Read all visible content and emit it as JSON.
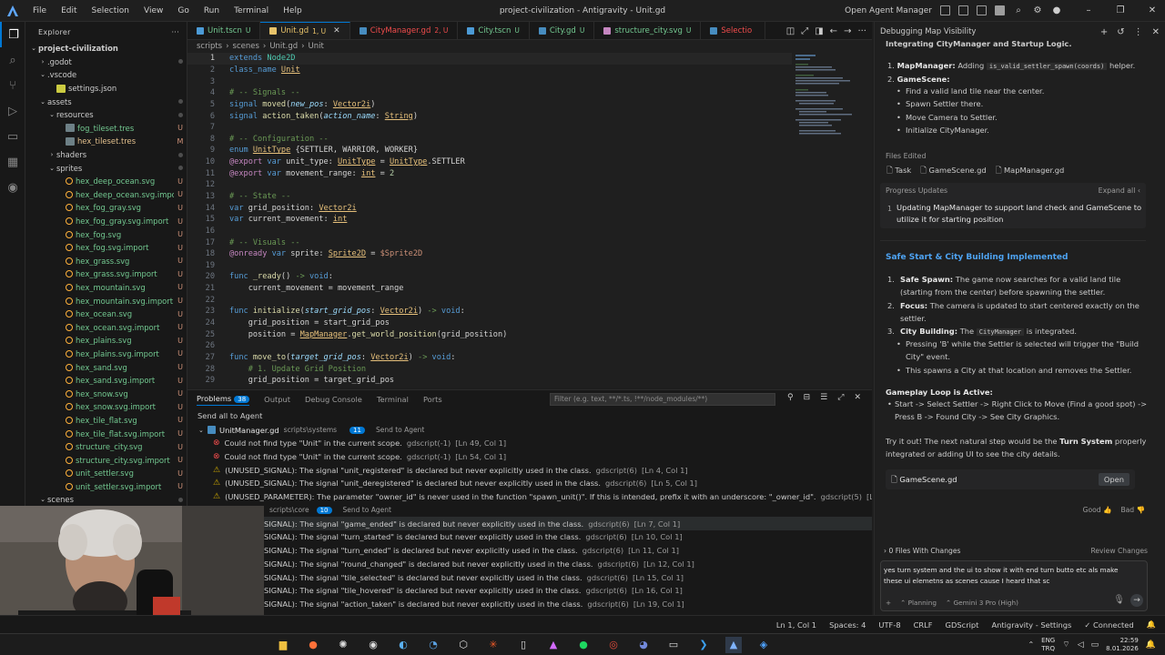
{
  "titlebar": {
    "menu": [
      "File",
      "Edit",
      "Selection",
      "View",
      "Go",
      "Run",
      "Terminal",
      "Help"
    ],
    "title": "project-civilization - Antigravity - Unit.gd",
    "open_agent_manager": "Open Agent Manager"
  },
  "explorer": {
    "header": "Explorer",
    "root": "project-civilization",
    "items": [
      {
        "name": ".godot",
        "depth": 1,
        "chev": "›",
        "type": "folder",
        "status": "",
        "dot": true
      },
      {
        "name": ".vscode",
        "depth": 1,
        "chev": "⌄",
        "type": "folder",
        "status": "",
        "dot": false
      },
      {
        "name": "settings.json",
        "depth": 2,
        "chev": "",
        "type": "json",
        "status": "",
        "dot": false
      },
      {
        "name": "assets",
        "depth": 1,
        "chev": "⌄",
        "type": "folder",
        "status": "",
        "dot": true
      },
      {
        "name": "resources",
        "depth": 2,
        "chev": "⌄",
        "type": "folder",
        "status": "",
        "dot": true
      },
      {
        "name": "fog_tileset.tres",
        "depth": 3,
        "chev": "",
        "type": "tres",
        "status": "U",
        "dot": false
      },
      {
        "name": "hex_tileset.tres",
        "depth": 3,
        "chev": "",
        "type": "tres",
        "status": "M",
        "dot": false
      },
      {
        "name": "shaders",
        "depth": 2,
        "chev": "›",
        "type": "folder",
        "status": "",
        "dot": true
      },
      {
        "name": "sprites",
        "depth": 2,
        "chev": "⌄",
        "type": "folder",
        "status": "",
        "dot": true
      },
      {
        "name": "hex_deep_ocean.svg",
        "depth": 3,
        "chev": "",
        "type": "svg",
        "status": "U",
        "dot": false
      },
      {
        "name": "hex_deep_ocean.svg.import",
        "depth": 3,
        "chev": "",
        "type": "svg",
        "status": "U",
        "dot": false
      },
      {
        "name": "hex_fog_gray.svg",
        "depth": 3,
        "chev": "",
        "type": "svg",
        "status": "U",
        "dot": false
      },
      {
        "name": "hex_fog_gray.svg.import",
        "depth": 3,
        "chev": "",
        "type": "svg",
        "status": "U",
        "dot": false
      },
      {
        "name": "hex_fog.svg",
        "depth": 3,
        "chev": "",
        "type": "svg",
        "status": "U",
        "dot": false
      },
      {
        "name": "hex_fog.svg.import",
        "depth": 3,
        "chev": "",
        "type": "svg",
        "status": "U",
        "dot": false
      },
      {
        "name": "hex_grass.svg",
        "depth": 3,
        "chev": "",
        "type": "svg",
        "status": "U",
        "dot": false
      },
      {
        "name": "hex_grass.svg.import",
        "depth": 3,
        "chev": "",
        "type": "svg",
        "status": "U",
        "dot": false
      },
      {
        "name": "hex_mountain.svg",
        "depth": 3,
        "chev": "",
        "type": "svg",
        "status": "U",
        "dot": false
      },
      {
        "name": "hex_mountain.svg.import",
        "depth": 3,
        "chev": "",
        "type": "svg",
        "status": "U",
        "dot": false
      },
      {
        "name": "hex_ocean.svg",
        "depth": 3,
        "chev": "",
        "type": "svg",
        "status": "U",
        "dot": false
      },
      {
        "name": "hex_ocean.svg.import",
        "depth": 3,
        "chev": "",
        "type": "svg",
        "status": "U",
        "dot": false
      },
      {
        "name": "hex_plains.svg",
        "depth": 3,
        "chev": "",
        "type": "svg",
        "status": "U",
        "dot": false
      },
      {
        "name": "hex_plains.svg.import",
        "depth": 3,
        "chev": "",
        "type": "svg",
        "status": "U",
        "dot": false
      },
      {
        "name": "hex_sand.svg",
        "depth": 3,
        "chev": "",
        "type": "svg",
        "status": "U",
        "dot": false
      },
      {
        "name": "hex_sand.svg.import",
        "depth": 3,
        "chev": "",
        "type": "svg",
        "status": "U",
        "dot": false
      },
      {
        "name": "hex_snow.svg",
        "depth": 3,
        "chev": "",
        "type": "svg",
        "status": "U",
        "dot": false
      },
      {
        "name": "hex_snow.svg.import",
        "depth": 3,
        "chev": "",
        "type": "svg",
        "status": "U",
        "dot": false
      },
      {
        "name": "hex_tile_flat.svg",
        "depth": 3,
        "chev": "",
        "type": "svg",
        "status": "U",
        "dot": false
      },
      {
        "name": "hex_tile_flat.svg.import",
        "depth": 3,
        "chev": "",
        "type": "svg",
        "status": "U",
        "dot": false
      },
      {
        "name": "structure_city.svg",
        "depth": 3,
        "chev": "",
        "type": "svg",
        "status": "U",
        "dot": false
      },
      {
        "name": "structure_city.svg.import",
        "depth": 3,
        "chev": "",
        "type": "svg",
        "status": "U",
        "dot": false
      },
      {
        "name": "unit_settler.svg",
        "depth": 3,
        "chev": "",
        "type": "svg",
        "status": "U",
        "dot": false
      },
      {
        "name": "unit_settler.svg.import",
        "depth": 3,
        "chev": "",
        "type": "svg",
        "status": "U",
        "dot": false
      },
      {
        "name": "scenes",
        "depth": 1,
        "chev": "⌄",
        "type": "folder",
        "status": "",
        "dot": true
      }
    ]
  },
  "tabs": [
    {
      "label": "Unit.tscn",
      "status": "U",
      "color": "#73c991",
      "active": false,
      "icon": "#4c9bd6"
    },
    {
      "label": "Unit.gd",
      "status": "1, U",
      "color": "#e8c36a",
      "active": true,
      "icon": "#e8c36a"
    },
    {
      "label": "CityManager.gd",
      "status": "2, U",
      "color": "#f14c4c",
      "active": false,
      "icon": "#478cbf"
    },
    {
      "label": "City.tscn",
      "status": "U",
      "color": "#73c991",
      "active": false,
      "icon": "#4c9bd6"
    },
    {
      "label": "City.gd",
      "status": "U",
      "color": "#73c991",
      "active": false,
      "icon": "#478cbf"
    },
    {
      "label": "structure_city.svg",
      "status": "U",
      "color": "#73c991",
      "active": false,
      "icon": "#c586c0"
    },
    {
      "label": "Selectio",
      "status": "",
      "color": "#f14c4c",
      "active": false,
      "icon": "#478cbf"
    }
  ],
  "breadcrumb": [
    "scripts",
    "scenes",
    "Unit.gd",
    "Unit"
  ],
  "code": [
    [
      [
        "kw",
        "extends "
      ],
      [
        "ty",
        "Node2D"
      ]
    ],
    [
      [
        "kw",
        "class_name "
      ],
      [
        "cls",
        "Unit"
      ]
    ],
    [],
    [
      [
        "cm",
        "# -- Signals --"
      ]
    ],
    [
      [
        "kw",
        "signal "
      ],
      [
        "fn",
        "moved"
      ],
      [
        "wh",
        "("
      ],
      [
        "pa",
        "new_pos"
      ],
      [
        "wh",
        ": "
      ],
      [
        "cls",
        "Vector2i"
      ],
      [
        "wh",
        ")"
      ]
    ],
    [
      [
        "kw",
        "signal "
      ],
      [
        "fn",
        "action_taken"
      ],
      [
        "wh",
        "("
      ],
      [
        "pa",
        "action_name"
      ],
      [
        "wh",
        ": "
      ],
      [
        "cls",
        "String"
      ],
      [
        "wh",
        ")"
      ]
    ],
    [],
    [
      [
        "cm",
        "# -- Configuration --"
      ]
    ],
    [
      [
        "kw",
        "enum "
      ],
      [
        "cls",
        "UnitType"
      ],
      [
        "wh",
        " {"
      ],
      [
        "wh",
        "SETTLER, WARRIOR, WORKER"
      ],
      [
        "wh",
        "}"
      ]
    ],
    [
      [
        "pl",
        "@export "
      ],
      [
        "kw",
        "var "
      ],
      [
        "wh",
        "unit_type: "
      ],
      [
        "cls",
        "UnitType"
      ],
      [
        "wh",
        " = "
      ],
      [
        "cls",
        "UnitType"
      ],
      [
        "wh",
        ".SETTLER"
      ]
    ],
    [
      [
        "pl",
        "@export "
      ],
      [
        "kw",
        "var "
      ],
      [
        "wh",
        "movement_range: "
      ],
      [
        "cls",
        "int"
      ],
      [
        "wh",
        " = "
      ],
      [
        "nu",
        "2"
      ]
    ],
    [],
    [
      [
        "cm",
        "# -- State --"
      ]
    ],
    [
      [
        "kw",
        "var "
      ],
      [
        "wh",
        "grid_position: "
      ],
      [
        "cls",
        "Vector2i"
      ]
    ],
    [
      [
        "kw",
        "var "
      ],
      [
        "wh",
        "current_movement: "
      ],
      [
        "cls",
        "int"
      ]
    ],
    [],
    [
      [
        "cm",
        "# -- Visuals --"
      ]
    ],
    [
      [
        "pl",
        "@onready "
      ],
      [
        "kw",
        "var "
      ],
      [
        "wh",
        "sprite: "
      ],
      [
        "cls",
        "Sprite2D"
      ],
      [
        "wh",
        " = "
      ],
      [
        "st",
        "$Sprite2D"
      ]
    ],
    [],
    [
      [
        "kw",
        "func "
      ],
      [
        "fn",
        "_ready"
      ],
      [
        "wh",
        "() "
      ],
      [
        "cm",
        "-> "
      ],
      [
        "kw",
        "void"
      ],
      [
        "wh",
        ":"
      ]
    ],
    [
      [
        "wh",
        "    current_movement = movement_range"
      ]
    ],
    [],
    [
      [
        "kw",
        "func "
      ],
      [
        "fn",
        "initialize"
      ],
      [
        "wh",
        "("
      ],
      [
        "pa",
        "start_grid_pos"
      ],
      [
        "wh",
        ": "
      ],
      [
        "cls",
        "Vector2i"
      ],
      [
        "wh",
        ") "
      ],
      [
        "cm",
        "-> "
      ],
      [
        "kw",
        "void"
      ],
      [
        "wh",
        ":"
      ]
    ],
    [
      [
        "wh",
        "    grid_position = start_grid_pos"
      ]
    ],
    [
      [
        "wh",
        "    position = "
      ],
      [
        "cls",
        "MapManager"
      ],
      [
        "wh",
        "."
      ],
      [
        "fn",
        "get_world_position"
      ],
      [
        "wh",
        "(grid_position)"
      ]
    ],
    [],
    [
      [
        "kw",
        "func "
      ],
      [
        "fn",
        "move_to"
      ],
      [
        "wh",
        "("
      ],
      [
        "pa",
        "target_grid_pos"
      ],
      [
        "wh",
        ": "
      ],
      [
        "cls",
        "Vector2i"
      ],
      [
        "wh",
        ") "
      ],
      [
        "cm",
        "-> "
      ],
      [
        "kw",
        "void"
      ],
      [
        "wh",
        ":"
      ]
    ],
    [
      [
        "cm",
        "    # 1. Update Grid Position"
      ]
    ],
    [
      [
        "wh",
        "    grid_position = target_grid_pos"
      ]
    ]
  ],
  "panel": {
    "tabs": [
      "Problems",
      "Output",
      "Debug Console",
      "Terminal",
      "Ports"
    ],
    "problems_count": "38",
    "filter_placeholder": "Filter (e.g. text, **/*.ts, !**/node_modules/**)",
    "send_all": "Send all to Agent",
    "group1": {
      "file": "UnitManager.gd",
      "path": "scripts\\systems",
      "count": "11",
      "send": "Send to Agent"
    },
    "rows1": [
      {
        "sev": "error",
        "text": "Could not find type \"Unit\" in the current scope.",
        "src": "gdscript(-1)",
        "pos": "[Ln 49, Col 1]"
      },
      {
        "sev": "error",
        "text": "Could not find type \"Unit\" in the current scope.",
        "src": "gdscript(-1)",
        "pos": "[Ln 54, Col 1]"
      },
      {
        "sev": "warn",
        "text": "(UNUSED_SIGNAL): The signal \"unit_registered\" is declared but never explicitly used in the class.",
        "src": "gdscript(6)",
        "pos": "[Ln 4, Col 1]"
      },
      {
        "sev": "warn",
        "text": "(UNUSED_SIGNAL): The signal \"unit_deregistered\" is declared but never explicitly used in the class.",
        "src": "gdscript(6)",
        "pos": "[Ln 5, Col 1]"
      },
      {
        "sev": "warn",
        "text": "(UNUSED_PARAMETER): The parameter \"owner_id\" is never used in the function \"spawn_unit()\". If this is intended, prefix it with an underscore: \"_owner_id\".",
        "src": "gdscript(5)",
        "pos": "[Ln 17, Col 1]"
      }
    ],
    "group2": {
      "path": "scripts\\core",
      "count": "10",
      "send": "Send to Agent"
    },
    "rows2": [
      {
        "text": "SIGNAL): The signal \"game_ended\" is declared but never explicitly used in the class.",
        "src": "gdscript(6)",
        "pos": "[Ln 7, Col 1]"
      },
      {
        "text": "SIGNAL): The signal \"turn_started\" is declared but never explicitly used in the class.",
        "src": "gdscript(6)",
        "pos": "[Ln 10, Col 1]"
      },
      {
        "text": "SIGNAL): The signal \"turn_ended\" is declared but never explicitly used in the class.",
        "src": "gdscript(6)",
        "pos": "[Ln 11, Col 1]"
      },
      {
        "text": "SIGNAL): The signal \"round_changed\" is declared but never explicitly used in the class.",
        "src": "gdscript(6)",
        "pos": "[Ln 12, Col 1]"
      },
      {
        "text": "SIGNAL): The signal \"tile_selected\" is declared but never explicitly used in the class.",
        "src": "gdscript(6)",
        "pos": "[Ln 15, Col 1]"
      },
      {
        "text": "SIGNAL): The signal \"tile_hovered\" is declared but never explicitly used in the class.",
        "src": "gdscript(6)",
        "pos": "[Ln 16, Col 1]"
      },
      {
        "text": "SIGNAL): The signal \"action_taken\" is declared but never explicitly used in the class.",
        "src": "gdscript(6)",
        "pos": "[Ln 19, Col 1]"
      }
    ]
  },
  "agent": {
    "header": "Debugging Map Visibility",
    "top_text": "Integrating CityManager and Startup Logic.",
    "list1": [
      {
        "n": "1.",
        "b": "MapManager:",
        "t": " Adding ",
        "code": "is_valid_settler_spawn(coords)",
        "t2": " helper."
      },
      {
        "n": "2.",
        "b": "GameScene:",
        "t": "",
        "code": "",
        "t2": ""
      }
    ],
    "bullets1": [
      "Find a valid land tile near the center.",
      "Spawn Settler there.",
      "Move Camera to Settler.",
      "Initialize CityManager."
    ],
    "files_edited_label": "Files Edited",
    "files_edited": [
      "Task",
      "GameScene.gd",
      "MapManager.gd"
    ],
    "progress_label": "Progress Updates",
    "expand_all": "Expand all",
    "progress_item_num": "1",
    "progress_item": "Updating MapManager to support land check and GameScene to utilize it for starting position",
    "heading": "Safe Start & City Building Implemented",
    "items2": [
      {
        "n": "1.",
        "b": "Safe Spawn:",
        "t": " The game now searches for a valid land tile (starting from the center) before spawning the settler."
      },
      {
        "n": "2.",
        "b": "Focus:",
        "t": " The camera is updated to start centered exactly on the settler."
      },
      {
        "n": "3.",
        "b": "City Building:",
        "t": " The ",
        "code": "CityManager",
        "t2": " is integrated."
      }
    ],
    "bullets2": [
      "Pressing 'B' while the Settler is selected will trigger the \"Build City\" event.",
      "This spawns a City at that location and removes the Settler."
    ],
    "loop_heading": "Gameplay Loop is Active:",
    "loop_text": "Start -> Select Settler -> Right Click to Move (Find a good spot) -> Press B -> Found City -> See City Graphics.",
    "try_pre": "Try it out! The next natural step would be the ",
    "try_bold": "Turn System",
    "try_post": " properly integrated or adding UI to see the city details.",
    "file_card": "GameScene.gd",
    "open_btn": "Open",
    "good": "Good",
    "bad": "Bad",
    "files_changes": "0 Files With Changes",
    "review": "Review Changes",
    "input_text": "yes turn system and the ui to show it with end turn butto etc als make these ui elemetns as scenes cause I heard that sc",
    "planning": "Planning",
    "model": "Gemini 3 Pro (High)"
  },
  "statusbar": [
    "Ln 1, Col 1",
    "Spaces: 4",
    "UTF-8",
    "CRLF",
    "GDScript",
    "Antigravity - Settings",
    "Connected"
  ],
  "taskbar": {
    "lang1": "ENG",
    "lang2": "TRQ",
    "time": "22:59",
    "date": "8.01.2026"
  }
}
